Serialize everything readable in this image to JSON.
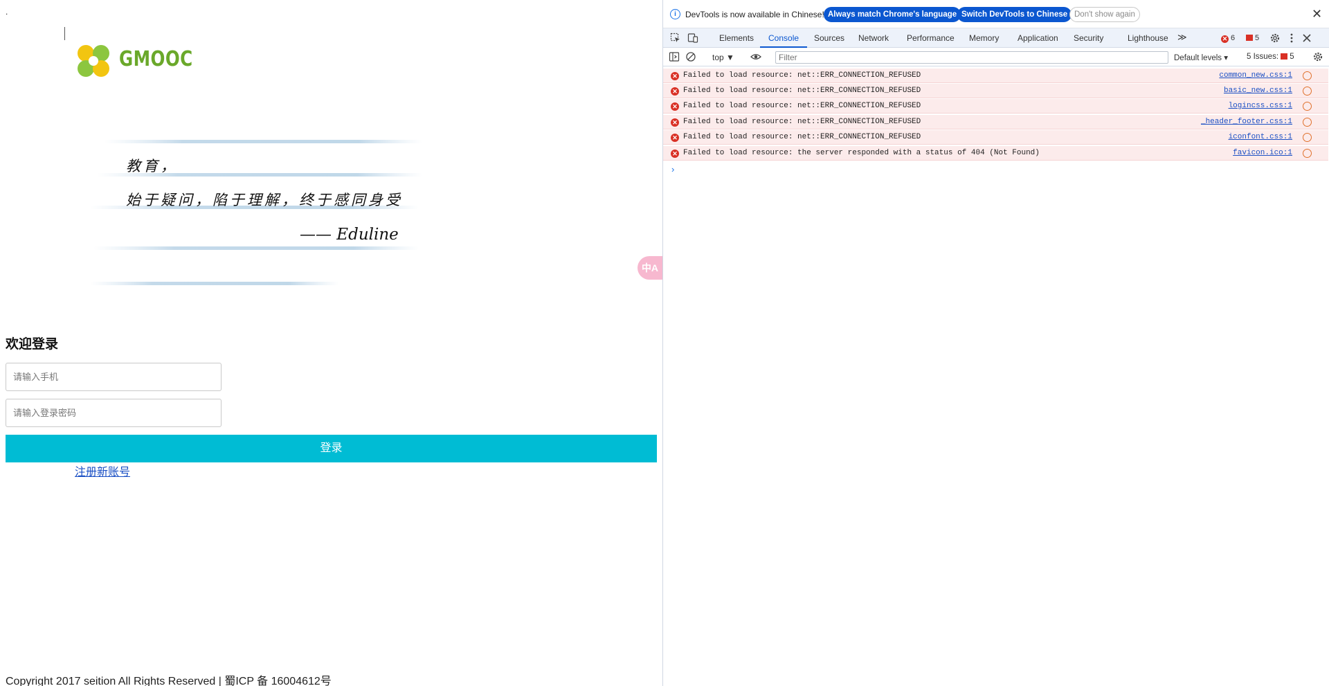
{
  "page": {
    "dot": ".",
    "logo_text": "GMOOC",
    "quote": {
      "line1": "教育，",
      "line2": "始于疑问，陷于理解，终于感同身受",
      "attribution": "—— Eduline"
    },
    "welcome_heading": "欢迎登录",
    "phone_placeholder": "请输入手机",
    "password_placeholder": "请输入登录密码",
    "login_button": "登录",
    "register_link": "注册新账号",
    "footer": "Copyright 2017 seition All Rights Reserved | 蜀ICP 备 16004612号",
    "translate_fab": "中A",
    "colors": {
      "logo_green": "#6aa82a",
      "logo_yellow": "#f2c511",
      "login_btn": "#00bcd4",
      "link": "#1a4fc4"
    }
  },
  "devtools": {
    "infobar": {
      "message": "DevTools is now available in Chinese!",
      "btn_match": "Always match Chrome's language",
      "btn_switch": "Switch DevTools to Chinese",
      "btn_dismiss": "Don't show again",
      "close": "✕"
    },
    "tabs": [
      "Elements",
      "Console",
      "Sources",
      "Network",
      "Performance",
      "Memory",
      "Application",
      "Security",
      "Lighthouse"
    ],
    "active_tab": "Console",
    "more_tabs": "≫",
    "error_count": "6",
    "issue_flag_count": "5",
    "toolbar": {
      "context": "top ▼",
      "filter_placeholder": "Filter",
      "levels": "Default levels ▾",
      "issues_label": "5 Issues:",
      "issues_count": "5"
    },
    "logs": [
      {
        "text": "Failed to load resource: net::ERR_CONNECTION_REFUSED",
        "source": "common_new.css:1"
      },
      {
        "text": "Failed to load resource: net::ERR_CONNECTION_REFUSED",
        "source": "basic_new.css:1"
      },
      {
        "text": "Failed to load resource: net::ERR_CONNECTION_REFUSED",
        "source": "logincss.css:1"
      },
      {
        "text": "Failed to load resource: net::ERR_CONNECTION_REFUSED",
        "source": "_header_footer.css:1"
      },
      {
        "text": "Failed to load resource: net::ERR_CONNECTION_REFUSED",
        "source": "iconfont.css:1"
      },
      {
        "text": "Failed to load resource: the server responded with a status of 404 (Not Found)",
        "source": "favicon.ico:1"
      }
    ],
    "prompt": "›"
  }
}
